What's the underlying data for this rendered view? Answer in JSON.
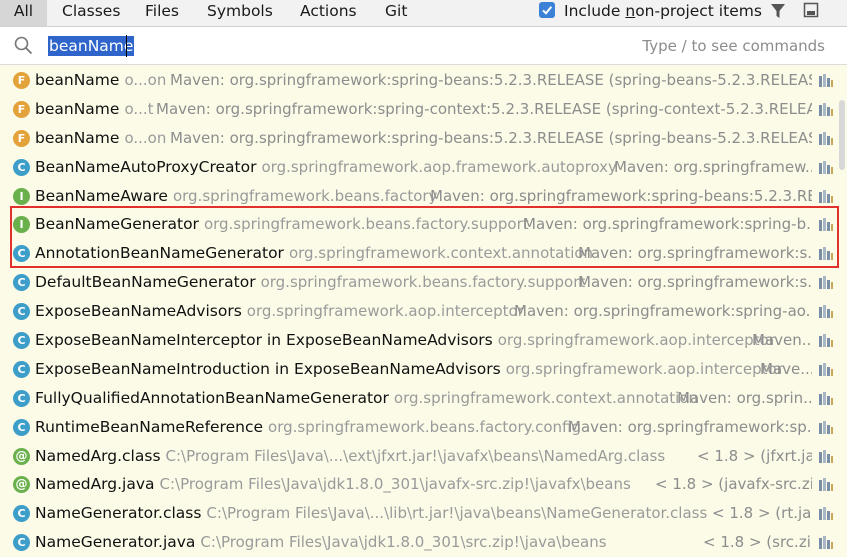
{
  "tabs": [
    {
      "label": "All",
      "active": true
    },
    {
      "label": "Classes",
      "active": false
    },
    {
      "label": "Files",
      "active": false
    },
    {
      "label": "Symbols",
      "active": false
    },
    {
      "label": "Actions",
      "active": false
    },
    {
      "label": "Git",
      "active": false
    }
  ],
  "include_option": {
    "checked": true,
    "label_pre": "Include ",
    "label_mnemonic": "n",
    "label_post": "on-project items"
  },
  "search": {
    "value": "beanName",
    "hint": "Type / to see commands"
  },
  "results": [
    {
      "icon": "field-icon",
      "kind": "f",
      "name": "beanName",
      "extra": "o...on",
      "location": "Maven: org.springframework:spring-beans:5.2.3.RELEASE (spring-beans-5.2.3.RELEASE.j..."
    },
    {
      "icon": "field-icon",
      "kind": "f",
      "name": "beanName",
      "extra": "o...t",
      "location": "Maven: org.springframework:spring-context:5.2.3.RELEASE (spring-context-5.2.3.RELEASE..."
    },
    {
      "icon": "field-icon",
      "kind": "f",
      "name": "beanName",
      "extra": "o...on",
      "location": "Maven: org.springframework:spring-beans:5.2.3.RELEASE (spring-beans-5.2.3.RELEASE.j..."
    },
    {
      "icon": "class-icon",
      "kind": "c",
      "name": "BeanNameAutoProxyCreator",
      "extra": "org.springframework.aop.framework.autoproxy",
      "location": "Maven: org.springframew..."
    },
    {
      "icon": "interface-icon",
      "kind": "i",
      "name": "BeanNameAware",
      "extra": "org.springframework.beans.factory",
      "location": "Maven: org.springframework:spring-beans:5.2.3.RE..."
    },
    {
      "icon": "interface-icon",
      "kind": "i",
      "name": "BeanNameGenerator",
      "extra": "org.springframework.beans.factory.support",
      "location": "Maven: org.springframework:spring-b..."
    },
    {
      "icon": "class-icon",
      "kind": "c",
      "name": "AnnotationBeanNameGenerator",
      "extra": "org.springframework.context.annotation",
      "location": "Maven: org.springframework:s..."
    },
    {
      "icon": "class-icon",
      "kind": "c",
      "name": "DefaultBeanNameGenerator",
      "extra": "org.springframework.beans.factory.support",
      "location": "Maven: org.springframework:s..."
    },
    {
      "icon": "class-icon",
      "kind": "c",
      "name": "ExposeBeanNameAdvisors",
      "extra": "org.springframework.aop.interceptor",
      "location": "Maven: org.springframework:spring-ao..."
    },
    {
      "icon": "class-icon",
      "kind": "c",
      "name": "ExposeBeanNameInterceptor in ExposeBeanNameAdvisors",
      "extra": "org.springframework.aop.interceptor",
      "location": "Maven..."
    },
    {
      "icon": "class-icon",
      "kind": "c",
      "name": "ExposeBeanNameIntroduction in ExposeBeanNameAdvisors",
      "extra": "org.springframework.aop.interceptor",
      "location": "Mave..."
    },
    {
      "icon": "class-icon",
      "kind": "c",
      "name": "FullyQualifiedAnnotationBeanNameGenerator",
      "extra": "org.springframework.context.annotation",
      "location": "Maven: org.sprin..."
    },
    {
      "icon": "class-icon",
      "kind": "c",
      "name": "RuntimeBeanNameReference",
      "extra": "org.springframework.beans.factory.config",
      "location": "Maven: org.springframework:sp..."
    },
    {
      "icon": "annotation-icon",
      "kind": "a",
      "name": "NamedArg.class",
      "extra": "C:\\Program Files\\Java\\...\\ext\\jfxrt.jar!\\javafx\\beans\\NamedArg.class",
      "location": "< 1.8 > (jfxrt.jar)"
    },
    {
      "icon": "annotation-icon",
      "kind": "a",
      "name": "NamedArg.java",
      "extra": "C:\\Program Files\\Java\\jdk1.8.0_301\\javafx-src.zip!\\javafx\\beans",
      "location": "< 1.8 > (javafx-src.zip)"
    },
    {
      "icon": "class-icon",
      "kind": "c",
      "name": "NameGenerator.class",
      "extra": "C:\\Program Files\\Java\\...\\lib\\rt.jar!\\java\\beans\\NameGenerator.class",
      "location": "< 1.8 > (rt.jar)"
    },
    {
      "icon": "class-icon",
      "kind": "c",
      "name": "NameGenerator.java",
      "extra": "C:\\Program Files\\Java\\jdk1.8.0_301\\src.zip!\\java\\beans",
      "location": "< 1.8 > (src.zip)"
    }
  ],
  "highlighted_rows": [
    5,
    6
  ],
  "colors": {
    "list_bg": "#fbfbe8",
    "selection_blue": "#2f65ca",
    "highlight_red": "#e0312c"
  }
}
